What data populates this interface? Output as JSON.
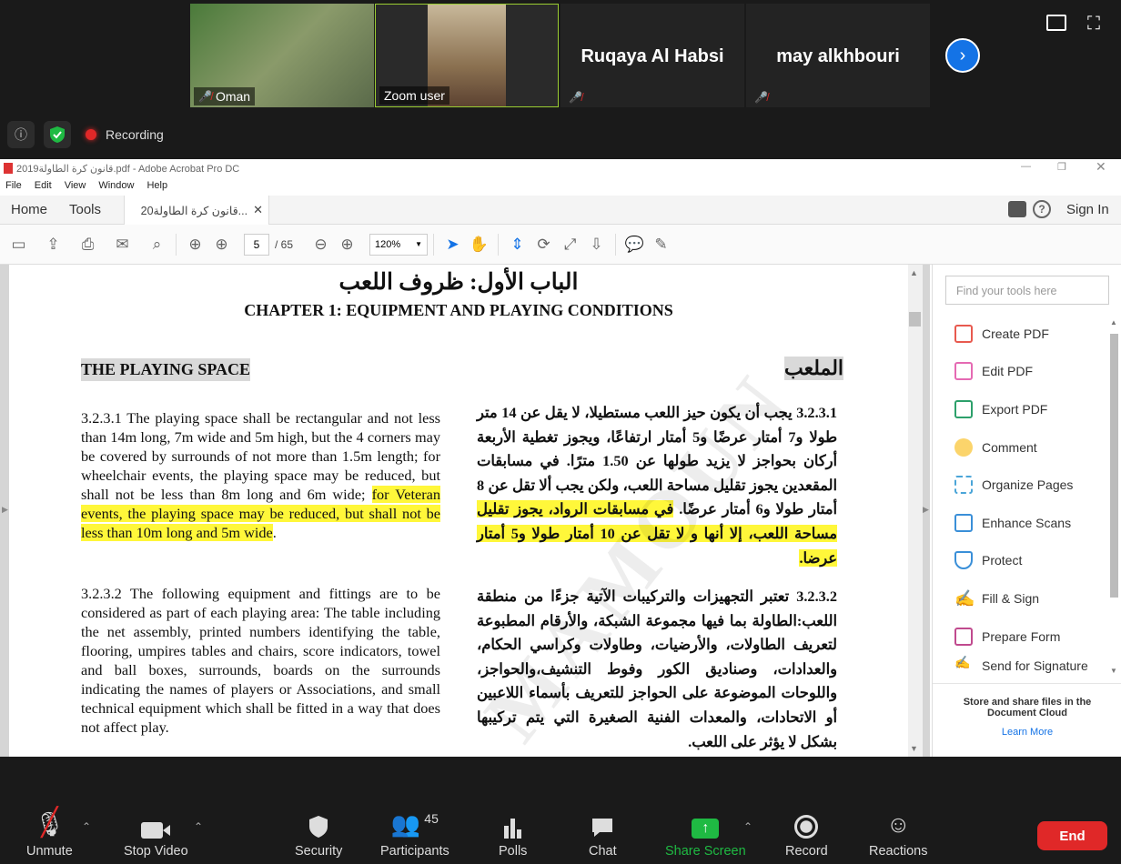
{
  "zoom": {
    "participants": [
      {
        "name": "Oman"
      },
      {
        "name": "Zoom user"
      },
      {
        "name": "Ruqaya Al Habsi"
      },
      {
        "name": "may alkhbouri"
      }
    ],
    "recording_label": "Recording",
    "controls": {
      "unmute": "Unmute",
      "stop_video": "Stop Video",
      "security": "Security",
      "participants": "Participants",
      "participants_count": "45",
      "polls": "Polls",
      "chat": "Chat",
      "share": "Share Screen",
      "record": "Record",
      "reactions": "Reactions",
      "end": "End"
    }
  },
  "acrobat": {
    "title": "قانون كرة الطاولة2019.pdf - Adobe Acrobat Pro DC",
    "menus": [
      "File",
      "Edit",
      "View",
      "Window",
      "Help"
    ],
    "home_tab": "Home",
    "tools_tab": "Tools",
    "doc_tab": "قانون كرة الطاولة20...",
    "sign_in": "Sign In",
    "page_current": "5",
    "page_total": "/ 65",
    "zoom_level": "120%",
    "search_placeholder": "Find your tools here",
    "tools": [
      "Create PDF",
      "Edit PDF",
      "Export PDF",
      "Comment",
      "Organize Pages",
      "Enhance Scans",
      "Protect",
      "Fill & Sign",
      "Prepare Form",
      "Send for Signature"
    ],
    "cloud_text": "Store and share files in the Document Cloud",
    "learn_more": "Learn More",
    "colors": {
      "accent": "#1473e6",
      "highlight": "#fff73a",
      "share_green": "#1fba43",
      "end_red": "#e02828"
    }
  },
  "doc": {
    "title_ar": "الباب الأول: ظروف اللعب",
    "title_en": "CHAPTER 1: EQUIPMENT AND PLAYING CONDITIONS",
    "section_en": "THE PLAYING SPACE",
    "section_ar": "الملعب",
    "p1_en": "3.2.3.1 The playing space shall be rectangular and not less than 14m long, 7m wide and 5m high, but the 4 corners may be covered by surrounds of not more than 1.5m length; for wheelchair events, the playing space may be reduced, but shall not be less than 8m long and 6m wide;",
    "p1_en_hl": "for Veteran events, the playing space may be reduced, but shall not be less than 10m long and 5m wide",
    "p1_en_end": ".",
    "p1_ar": "3.2.3.1 يجب أن يكون حيز اللعب مستطيلا، لا يقل عن 14 متر طولا و7 أمتار عرضًا و5 أمتار ارتفاعًا، ويجوز تغطية الأربعة أركان بحواجز لا يزيد طولها عن 1.50 مترًا. في مسابقات المقعدين يجوز تقليل مساحة اللعب، ولكن يجب ألا تقل عن 8 أمتار طولا و6 أمتار عرضًا.",
    "p1_ar_hl": "في مسابقات الرواد، يجوز تقليل مساحة اللعب، إلا أنها و لا تقل عن 10 أمتار طولا و5 أمتار عرضا.",
    "p2_en": "3.2.3.2 The following equipment and fittings are to be considered as part of each playing area: The table including the net assembly, printed numbers identifying the table, flooring, umpires tables and chairs, score indicators, towel and ball boxes, surrounds, boards on the surrounds indicating the names of players or Associations, and small technical equipment which shall be fitted in a way that does not affect play.",
    "p2_ar": "3.2.3.2 تعتبر التجهيزات والتركيبات الآتية جزءًا من منطقة اللعب:الطاولة بما فيها مجموعة الشبكة، والأرقام المطبوعة لتعريف الطاولات، والأرضيات، وطاولات وكراسي الحكام، والعدادات، وصناديق الكور وفوط التنشيف،والحواجز، واللوحات الموضوعة على الحواجز للتعريف بأسماء اللاعبين أو الاتحادات، والمعدات الفنية الصغيرة التي يتم تركيبها بشكل لا يؤثر على اللعب.",
    "watermark": "MAMOUN"
  }
}
